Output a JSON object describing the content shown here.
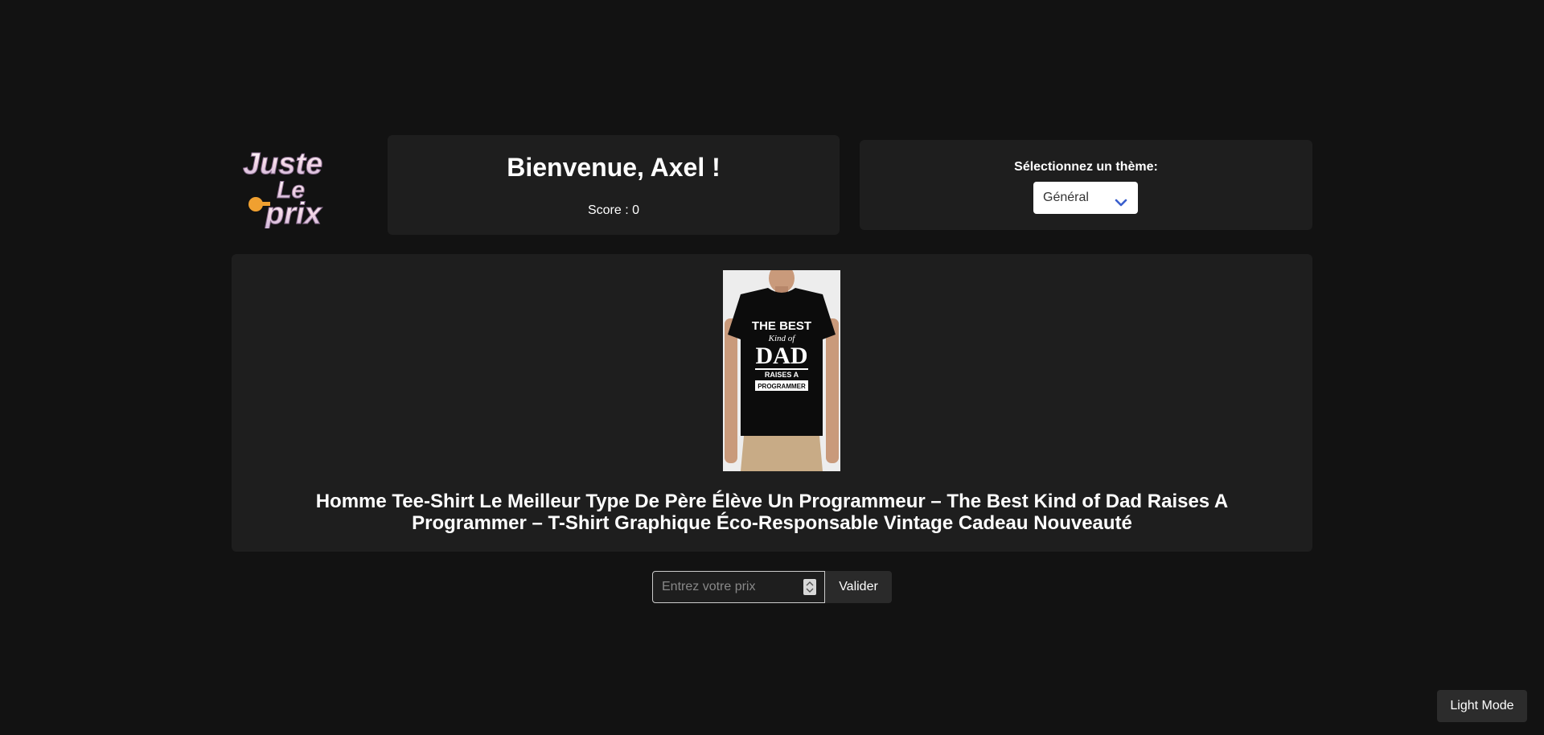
{
  "logo": {
    "alt_text": "Juste Le prix",
    "line1": "Juste",
    "line2": "Le",
    "line3": "prix"
  },
  "header": {
    "welcome": "Bienvenue, Axel !",
    "score": "Score : 0"
  },
  "theme": {
    "label": "Sélectionnez un thème:",
    "selected": "Général",
    "icon": "chevron-down-icon"
  },
  "product": {
    "image_icon": "tshirt-image",
    "title": "Homme Tee-Shirt Le Meilleur Type De Père Élève Un Programmeur – The Best Kind of Dad Raises A Programmer – T-Shirt Graphique Éco-Responsable Vintage Cadeau Nouveauté"
  },
  "guess": {
    "placeholder": "Entrez votre prix",
    "submit_label": "Valider"
  },
  "mode_toggle": {
    "label": "Light Mode"
  },
  "colors": {
    "background": "#121212",
    "card": "#1e1e1e",
    "accent": "#3a5fcd"
  }
}
